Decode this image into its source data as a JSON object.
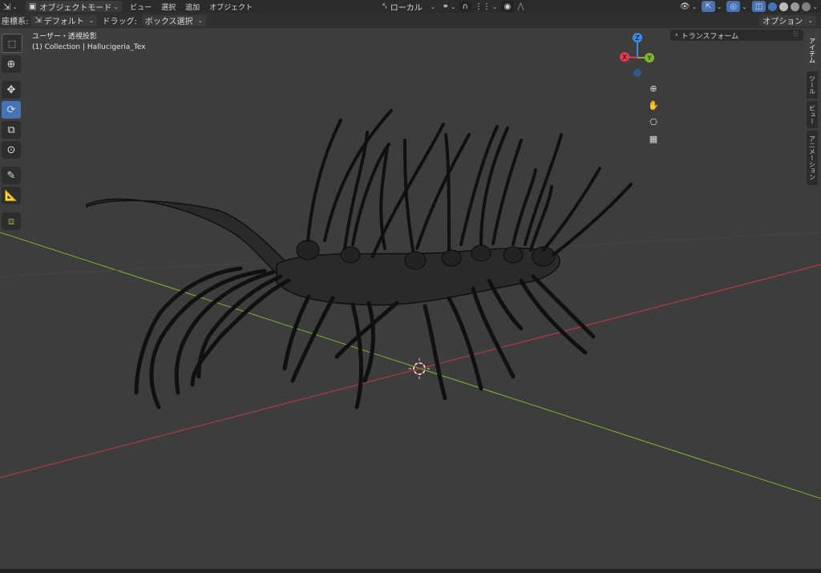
{
  "header": {
    "editor_type_icon": "axis-icon",
    "mode": "オブジェクトモード",
    "menus": [
      "ビュー",
      "選択",
      "追加",
      "オブジェクト"
    ],
    "transform_orientation": "ローカル"
  },
  "toolheader": {
    "orientation_label": "座標系:",
    "orientation_value": "デフォルト",
    "drag_label": "ドラッグ:",
    "drag_value": "ボックス選択",
    "options_label": "オプション"
  },
  "viewport": {
    "view_name": "ユーザー・透視投影",
    "collection_info": "(1) Collection | Hallucigeria_Tex"
  },
  "gizmo": {
    "z": "Z",
    "x": "X",
    "y": "Y"
  },
  "npanel": {
    "header": "トランスフォーム"
  },
  "sidebar_tabs": [
    "アイテム",
    "ツール",
    "ビュー",
    "アニメーション"
  ],
  "colors": {
    "accent": "#4772b3",
    "x_axis": "#e23b4e",
    "y_axis": "#7fb52b",
    "z_axis": "#3d8ae2",
    "background": "#3d3d3d"
  }
}
